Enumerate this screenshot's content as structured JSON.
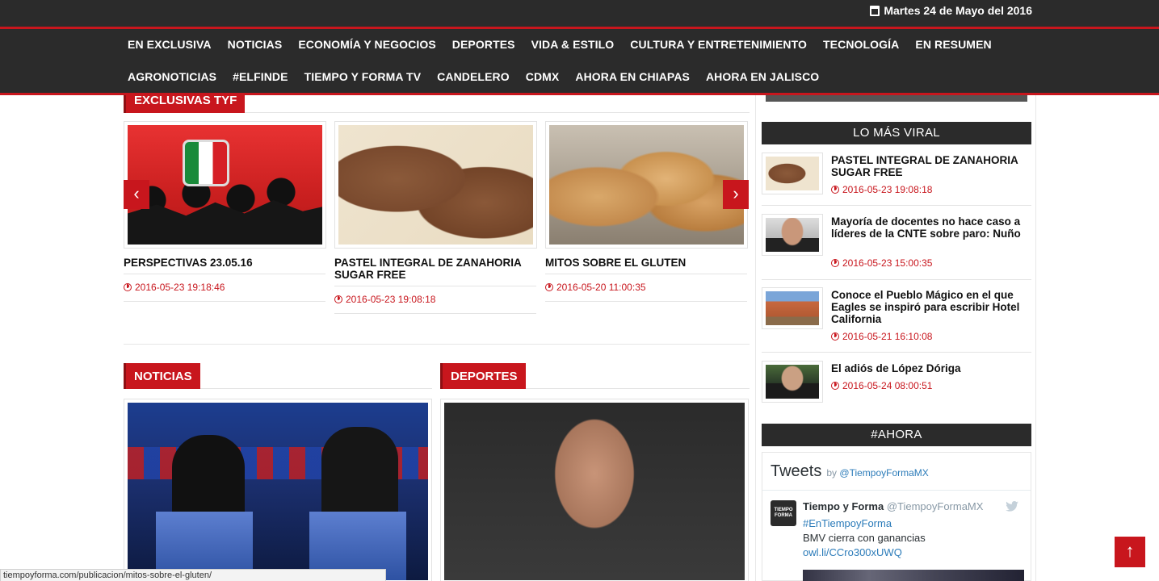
{
  "header": {
    "date": "Martes 24 de Mayo del 2016",
    "nav_row1": [
      "EN EXCLUSIVA",
      "NOTICIAS",
      "ECONOMÍA Y NEGOCIOS",
      "DEPORTES",
      "VIDA & ESTILO",
      "CULTURA Y ENTRETENIMIENTO",
      "TECNOLOGÍA",
      "EN RESUMEN"
    ],
    "nav_row2": [
      "AGRONOTICIAS",
      "#ELFINDE",
      "TIEMPO Y FORMA TV",
      "CANDELERO",
      "CDMX",
      "AHORA EN CHIAPAS",
      "AHORA EN JALISCO"
    ]
  },
  "exclusivas": {
    "heading": "EXCLUSIVAS TYF",
    "items": [
      {
        "title": "PERSPECTIVAS 23.05.16",
        "date": "2016-05-23 19:18:46"
      },
      {
        "title": "PASTEL INTEGRAL DE ZANAHORIA SUGAR FREE",
        "date": "2016-05-23 19:08:18"
      },
      {
        "title": "MITOS SOBRE EL GLUTEN",
        "date": "2016-05-20 11:00:35"
      }
    ],
    "prev_icon": "chevron-left-icon",
    "next_icon": "chevron-right-icon"
  },
  "sections": {
    "noticias": "NOTICIAS",
    "deportes": "DEPORTES"
  },
  "sidebar": {
    "viral_heading": "LO MÁS VIRAL",
    "viral": [
      {
        "title": "PASTEL INTEGRAL DE ZANAHORIA SUGAR FREE",
        "date": "2016-05-23 19:08:18"
      },
      {
        "title": "Mayoría de docentes no hace caso a líderes de la CNTE sobre paro: Nuño",
        "date": "2016-05-23 15:00:35"
      },
      {
        "title": "Conoce el Pueblo Mágico en el que Eagles se inspiró para escribir Hotel California",
        "date": "2016-05-21 16:10:08"
      },
      {
        "title": "El adiós de López Dóriga",
        "date": "2016-05-24 08:00:51"
      }
    ],
    "ahora_heading": "#AHORA"
  },
  "twitter": {
    "title": "Tweets",
    "by": "by",
    "by_handle": "@TiempoyFormaMX",
    "avatar_text": "TIEMPO FORMA",
    "author": "Tiempo y Forma",
    "author_handle": "@TiempoyFormaMX",
    "hashtag": "#EnTiempoyForma",
    "text": "BMV cierra con ganancias",
    "link": "owl.li/CCro300xUWQ"
  },
  "status_url": "tiempoyforma.com/publicacion/mitos-sobre-el-gluten/",
  "back_to_top": "↑",
  "colors": {
    "accent": "#c8161d",
    "header_bg": "#2b2b2b"
  }
}
